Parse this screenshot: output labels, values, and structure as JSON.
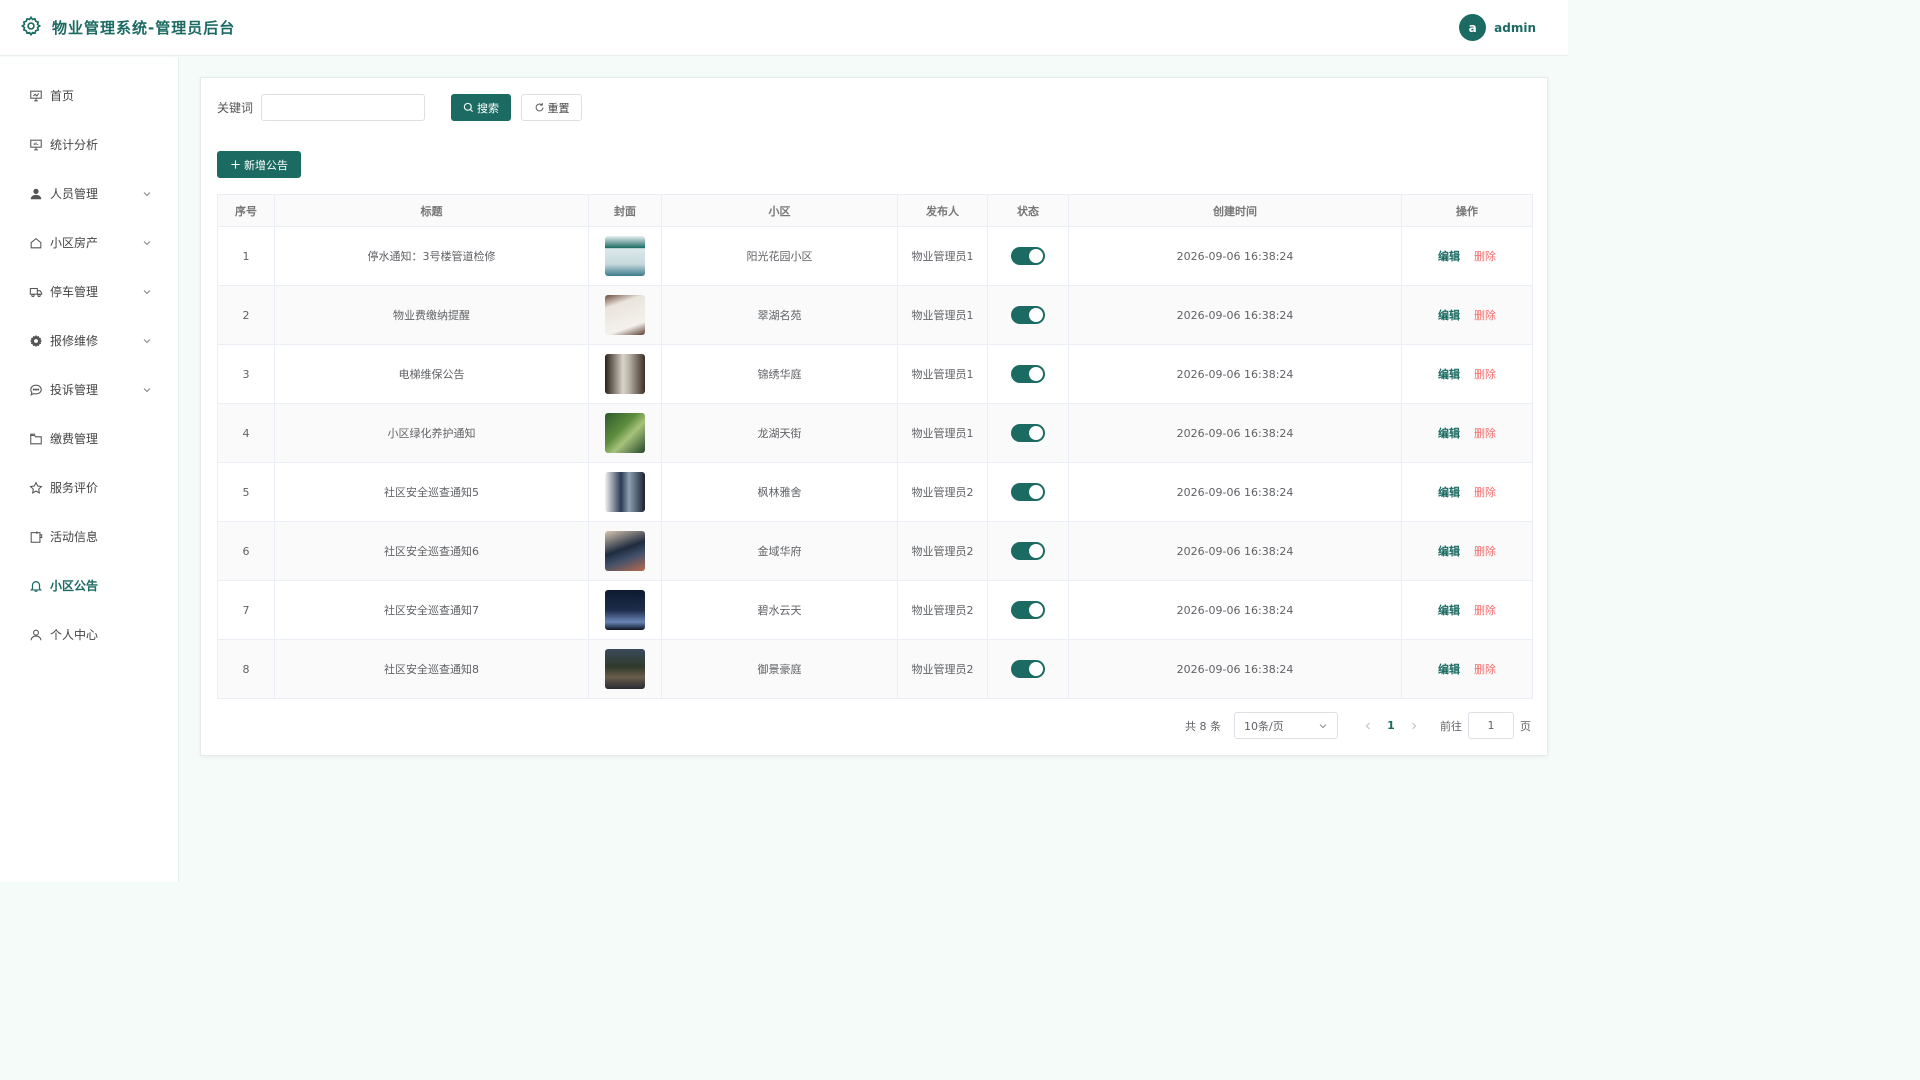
{
  "header": {
    "title": "物业管理系统-管理员后台",
    "avatar_letter": "a",
    "username": "admin"
  },
  "sidebar": {
    "items": [
      {
        "label": "首页",
        "icon": "presentation-icon"
      },
      {
        "label": "统计分析",
        "icon": "chart-board-icon"
      },
      {
        "label": "人员管理",
        "icon": "user-icon",
        "expandable": true
      },
      {
        "label": "小区房产",
        "icon": "house-icon",
        "expandable": true
      },
      {
        "label": "停车管理",
        "icon": "truck-icon",
        "expandable": true
      },
      {
        "label": "报修维修",
        "icon": "gear-icon",
        "expandable": true
      },
      {
        "label": "投诉管理",
        "icon": "chat-icon",
        "expandable": true
      },
      {
        "label": "缴费管理",
        "icon": "wallet-icon"
      },
      {
        "label": "服务评价",
        "icon": "star-icon"
      },
      {
        "label": "活动信息",
        "icon": "notebook-icon"
      },
      {
        "label": "小区公告",
        "icon": "bell-icon",
        "active": true
      },
      {
        "label": "个人中心",
        "icon": "person-icon"
      }
    ]
  },
  "search": {
    "label": "关键词",
    "value": "",
    "search_button": "搜索",
    "reset_button": "重置"
  },
  "add_button": "新增公告",
  "table": {
    "columns": [
      "序号",
      "标题",
      "封面",
      "小区",
      "发布人",
      "状态",
      "创建时间",
      "操作"
    ],
    "edit_label": "编辑",
    "delete_label": "删除",
    "rows": [
      {
        "index": "1",
        "title": "停水通知：3号楼管道检修",
        "community": "阳光花园小区",
        "publisher": "物业管理员1",
        "status": true,
        "created": "2026-09-06 16:38:24"
      },
      {
        "index": "2",
        "title": "物业费缴纳提醒",
        "community": "翠湖名苑",
        "publisher": "物业管理员1",
        "status": true,
        "created": "2026-09-06 16:38:24"
      },
      {
        "index": "3",
        "title": "电梯维保公告",
        "community": "锦绣华庭",
        "publisher": "物业管理员1",
        "status": true,
        "created": "2026-09-06 16:38:24"
      },
      {
        "index": "4",
        "title": "小区绿化养护通知",
        "community": "龙湖天街",
        "publisher": "物业管理员1",
        "status": true,
        "created": "2026-09-06 16:38:24"
      },
      {
        "index": "5",
        "title": "社区安全巡查通知5",
        "community": "枫林雅舍",
        "publisher": "物业管理员2",
        "status": true,
        "created": "2026-09-06 16:38:24"
      },
      {
        "index": "6",
        "title": "社区安全巡查通知6",
        "community": "金域华府",
        "publisher": "物业管理员2",
        "status": true,
        "created": "2026-09-06 16:38:24"
      },
      {
        "index": "7",
        "title": "社区安全巡查通知7",
        "community": "碧水云天",
        "publisher": "物业管理员2",
        "status": true,
        "created": "2026-09-06 16:38:24"
      },
      {
        "index": "8",
        "title": "社区安全巡查通知8",
        "community": "御景豪庭",
        "publisher": "物业管理员2",
        "status": true,
        "created": "2026-09-06 16:38:24"
      }
    ]
  },
  "pagination": {
    "total": "共 8 条",
    "page_size": "10条/页",
    "current_page": "1",
    "goto_label": "前往",
    "goto_value": "1",
    "page_unit": "页"
  },
  "colors": {
    "primary": "#1c6b63",
    "danger": "#f56c6c",
    "background": "#f4fbf9"
  }
}
